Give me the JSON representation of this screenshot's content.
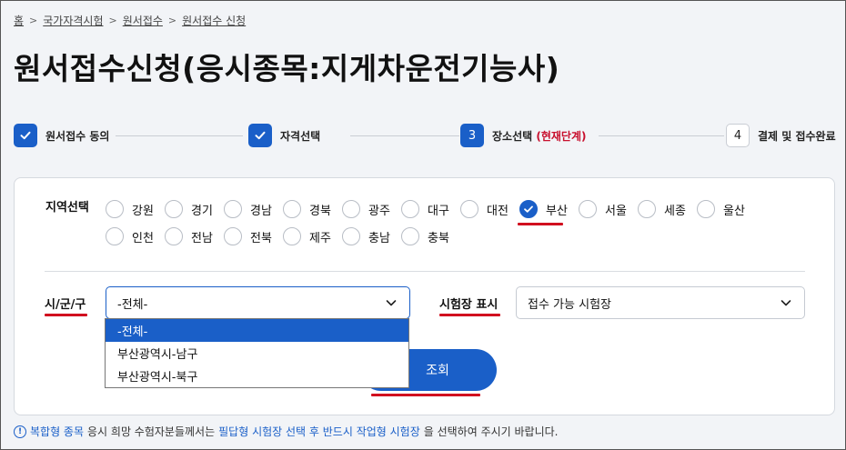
{
  "breadcrumb": {
    "items": [
      "홈",
      "국가자격시험",
      "원서접수",
      "원서접수 신청"
    ],
    "separator": ">"
  },
  "page_title": "원서접수신청(응시종목:지게차운전기능사)",
  "steps": [
    {
      "label": "원서접수 동의",
      "state": "done",
      "marker": "check-icon"
    },
    {
      "label": "자격선택",
      "state": "done",
      "marker": "check-icon"
    },
    {
      "label": "장소선택",
      "number": "3",
      "current_label": "(현재단계)",
      "state": "current"
    },
    {
      "label": "결제 및 접수완료",
      "number": "4",
      "state": "pending"
    }
  ],
  "region": {
    "label": "지역선택",
    "options": [
      "강원",
      "경기",
      "경남",
      "경북",
      "광주",
      "대구",
      "대전",
      "부산",
      "서울",
      "세종",
      "울산",
      "인천",
      "전남",
      "전북",
      "제주",
      "충남",
      "충북"
    ],
    "selected": "부산"
  },
  "district": {
    "label": "시/군/구",
    "value": "-전체-",
    "options": [
      "-전체-",
      "부산광역시-남구",
      "부산광역시-북구"
    ],
    "highlighted_option": "-전체-"
  },
  "venue_display": {
    "label": "시험장 표시",
    "value": "접수 가능 시험장"
  },
  "search_button": {
    "label": "조회"
  },
  "notice": {
    "icon": "info-icon",
    "icon_glyph": "!",
    "part1": "복합형 종목",
    "part2": " 응시 희망 수험자분들께서는 ",
    "part3": "필답형 시험장 선택 후 반드시 작업형 시험장",
    "part4": "을 선택하여 주시기 바랍니다."
  },
  "colors": {
    "primary": "#1a5fc8",
    "accent_red": "#d10f1f",
    "current_step": "#c8102e",
    "background": "#f2f4f7"
  }
}
